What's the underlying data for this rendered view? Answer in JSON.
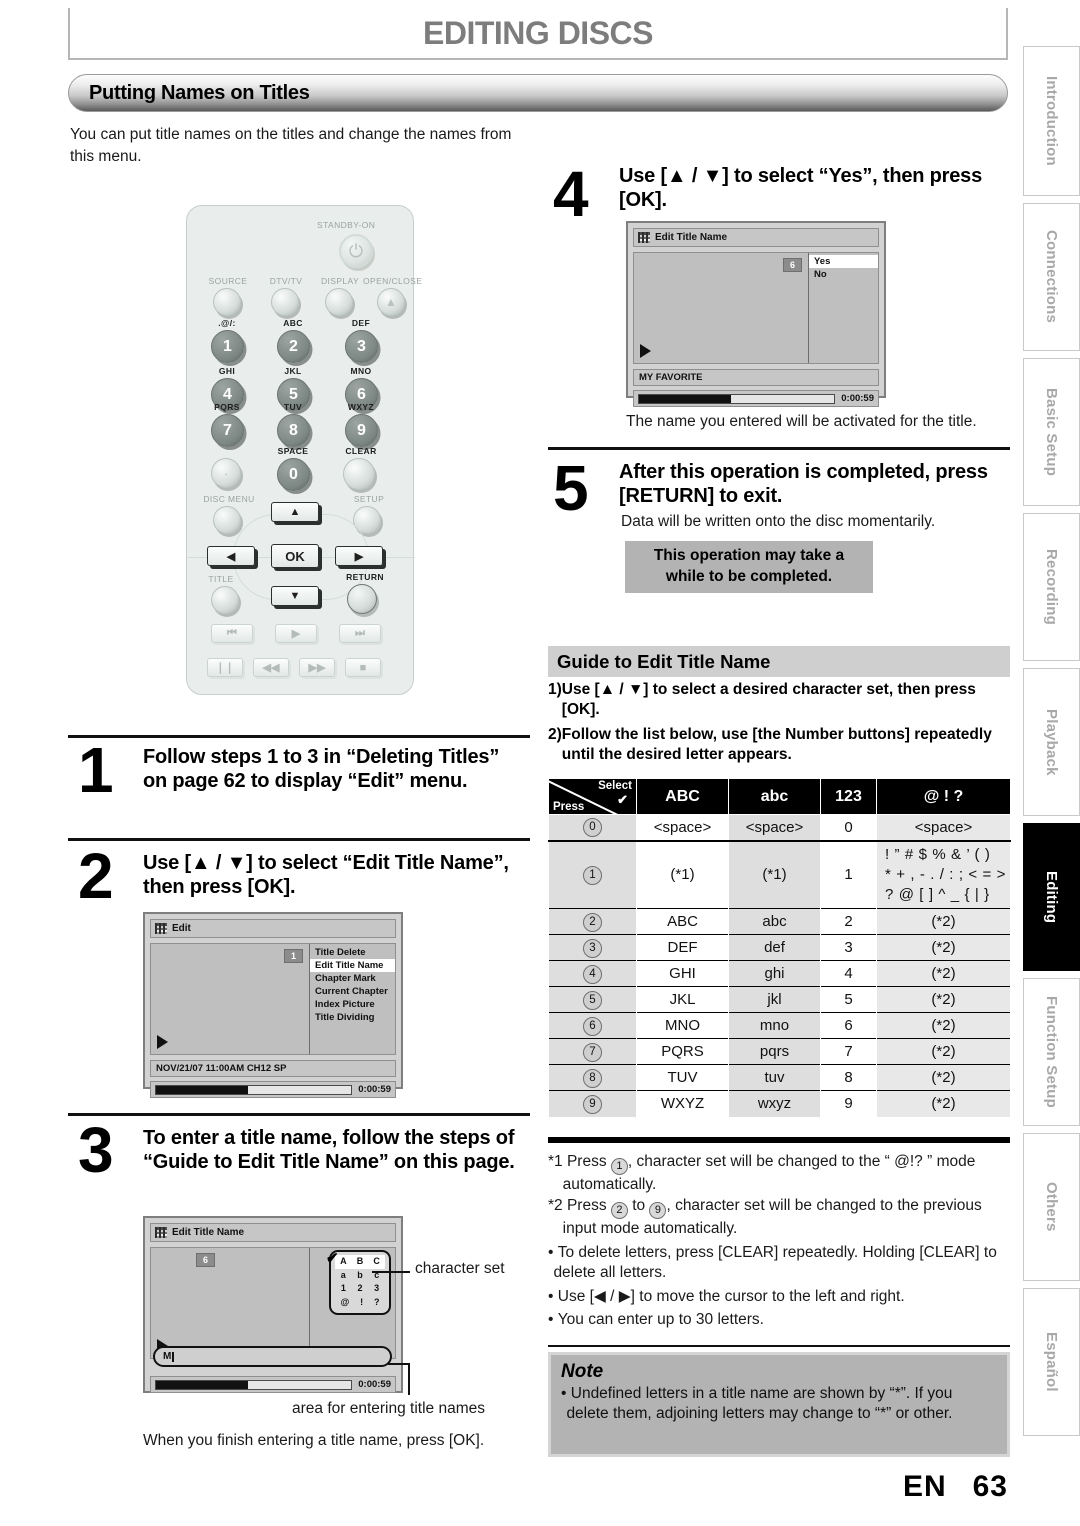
{
  "chapter": {
    "title": "EDITING DISCS"
  },
  "section": {
    "title": "Putting Names on Titles"
  },
  "intro": "You can put title names on the titles and change the names from this menu.",
  "remote": {
    "standby_label": "STANDBY-ON",
    "row_labels": [
      "SOURCE",
      "DTV/TV",
      "DISPLAY",
      "OPEN/CLOSE"
    ],
    "keys": [
      {
        "num": "1",
        "letters": ".@/:"
      },
      {
        "num": "2",
        "letters": "ABC"
      },
      {
        "num": "3",
        "letters": "DEF"
      },
      {
        "num": "4",
        "letters": "GHI"
      },
      {
        "num": "5",
        "letters": "JKL"
      },
      {
        "num": "6",
        "letters": "MNO"
      },
      {
        "num": "7",
        "letters": "PQRS"
      },
      {
        "num": "8",
        "letters": "TUV"
      },
      {
        "num": "9",
        "letters": "WXYZ"
      },
      {
        "num": "0",
        "letters": "SPACE"
      }
    ],
    "clear_label": "CLEAR",
    "disc_menu_label": "DISC MENU",
    "setup_label": "SETUP",
    "title_label": "TITLE",
    "return_label": "RETURN",
    "ok_label": "OK",
    "up_glyph": "▲",
    "down_glyph": "▼",
    "left_glyph": "◀",
    "right_glyph": "▶",
    "transport_row1": [
      "⏮",
      "▶",
      "⏭"
    ],
    "transport_row2": [
      "❘❘",
      "◀◀",
      "▶▶",
      "■"
    ]
  },
  "steps": [
    {
      "num": "1",
      "text": "Follow steps 1 to 3 in “Deleting Titles” on page 62 to display “Edit” menu."
    },
    {
      "num": "2",
      "text": "Use [▲ / ▼] to select “Edit Title Name”, then press [OK]."
    },
    {
      "num": "3",
      "text": "To enter a title name, follow the steps of “Guide to Edit Title Name” on this page."
    },
    {
      "num": "4",
      "text": "Use [▲ / ▼] to select “Yes”, then press [OK].",
      "sub": "The name you entered will be activated for the title."
    },
    {
      "num": "5",
      "text": "After this operation is completed, press [RETURN] to exit.",
      "sub": "Data will be written onto the disc momentarily.",
      "callout": [
        "This operation may take a",
        "while to be completed."
      ]
    }
  ],
  "osd_edit": {
    "title": "Edit",
    "badge": "1",
    "menu": [
      "Title Delete",
      "Edit Title Name",
      "Chapter Mark",
      "Current Chapter",
      "Index Picture",
      "Title Dividing"
    ],
    "selected": "Edit Title Name",
    "caption": "NOV/21/07 11:00AM CH12 SP",
    "time": "0:00:59"
  },
  "osd_entry": {
    "title": "Edit Title Name",
    "badge": "6",
    "charset_rows": [
      [
        "A",
        "B",
        "C"
      ],
      [
        "a",
        "b",
        "c"
      ],
      [
        "1",
        "2",
        "3"
      ],
      [
        "@",
        "!",
        "?"
      ]
    ],
    "name_value": "M",
    "time": "0:00:59"
  },
  "osd_yes_no": {
    "title": "Edit Title Name",
    "badge": "6",
    "options": [
      "Yes",
      "No"
    ],
    "selected": "Yes",
    "caption": "MY FAVORITE",
    "time": "0:00:59"
  },
  "callouts": {
    "charset": "character set",
    "name_area": "area for entering title names",
    "finish": "When you finish entering a title name, press [OK]."
  },
  "guide": {
    "heading": "Guide to Edit Title Name",
    "items": [
      {
        "mark": "1)",
        "text": "Use [▲ / ▼] to select a desired character set, then press [OK]."
      },
      {
        "mark": "2)",
        "text": "Follow the list below, use [the Number buttons] repeatedly until the desired letter appears."
      }
    ]
  },
  "char_table": {
    "corner": {
      "select": "Select",
      "press": "Press",
      "check": "✔"
    },
    "columns": [
      "ABC",
      "abc",
      "123",
      "@ ! ?"
    ],
    "rows": [
      {
        "key": "0",
        "cells": [
          "<space>",
          "<space>",
          "0",
          "<space>"
        ]
      },
      {
        "key": "1",
        "cells": [
          "(*1)",
          "(*1)",
          "1",
          "! ” # $ % & ’ ( )\n* + , - . / : ; < = >\n? @ [ ] ^ _ { | }"
        ]
      },
      {
        "key": "2",
        "cells": [
          "ABC",
          "abc",
          "2",
          "(*2)"
        ]
      },
      {
        "key": "3",
        "cells": [
          "DEF",
          "def",
          "3",
          "(*2)"
        ]
      },
      {
        "key": "4",
        "cells": [
          "GHI",
          "ghi",
          "4",
          "(*2)"
        ]
      },
      {
        "key": "5",
        "cells": [
          "JKL",
          "jkl",
          "5",
          "(*2)"
        ]
      },
      {
        "key": "6",
        "cells": [
          "MNO",
          "mno",
          "6",
          "(*2)"
        ]
      },
      {
        "key": "7",
        "cells": [
          "PQRS",
          "pqrs",
          "7",
          "(*2)"
        ]
      },
      {
        "key": "8",
        "cells": [
          "TUV",
          "tuv",
          "8",
          "(*2)"
        ]
      },
      {
        "key": "9",
        "cells": [
          "WXYZ",
          "wxyz",
          "9",
          "(*2)"
        ]
      }
    ]
  },
  "footnotes": [
    {
      "mark": "*1",
      "pre": "Press ",
      "key1": "1",
      "post": ", character set will be changed to the “ @!? ” mode automatically."
    },
    {
      "mark": "*2",
      "pre": "Press ",
      "key1": "2",
      "mid": " to ",
      "key2": "9",
      "post": ", character set will be changed to the previous input mode automatically."
    },
    {
      "mark": "•",
      "text": "To delete letters, press [CLEAR] repeatedly. Holding [CLEAR] to delete all letters."
    },
    {
      "mark": "•",
      "text": "Use [◀ / ▶] to move the cursor to the left and right."
    },
    {
      "mark": "•",
      "text": "You can enter up to 30 letters."
    }
  ],
  "note": {
    "title": "Note",
    "bullet": "•",
    "text": "Undefined letters in a title name are shown by “*”. If you delete them, adjoining letters may change to “*” or other."
  },
  "tabs": [
    {
      "label": "Introduction",
      "active": false
    },
    {
      "label": "Connections",
      "active": false
    },
    {
      "label": "Basic Setup",
      "active": false
    },
    {
      "label": "Recording",
      "active": false
    },
    {
      "label": "Playback",
      "active": false
    },
    {
      "label": "Editing",
      "active": true
    },
    {
      "label": "Function Setup",
      "active": false
    },
    {
      "label": "Others",
      "active": false
    },
    {
      "label": "Español",
      "active": false
    }
  ],
  "footer": {
    "lang": "EN",
    "page": "63"
  }
}
